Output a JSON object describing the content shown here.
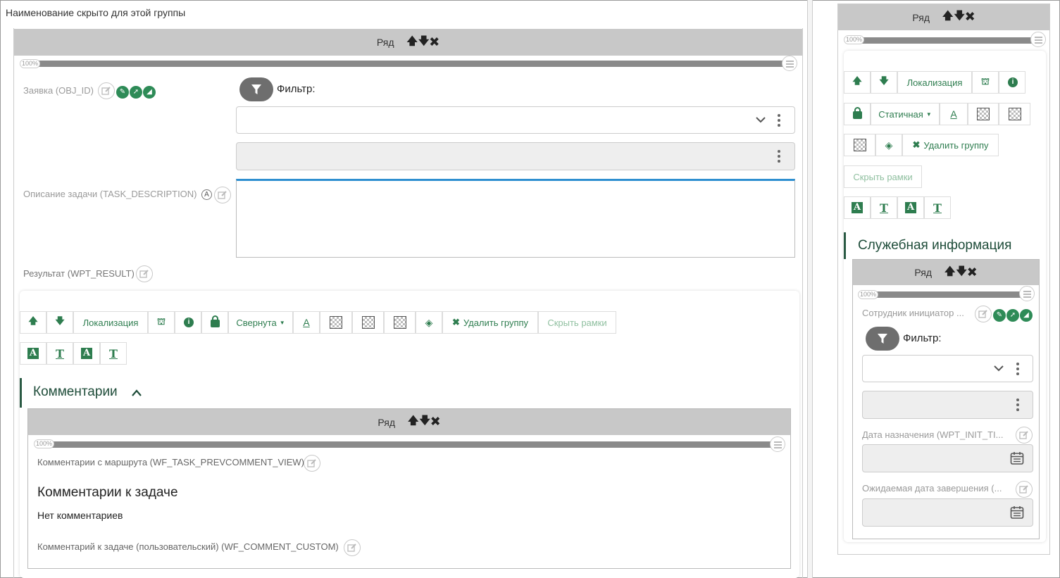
{
  "group_title": "Наименование скрыто для этой группы",
  "row_label": "Ряд",
  "row_controls": "🡅🡇✖",
  "percent": "100%",
  "main": {
    "obj_id_label": "Заявка (OBJ_ID)",
    "filter_label": "Фильтр:",
    "task_desc_label": "Описание задачи (TASK_DESCRIPTION)",
    "result_label": "Результат (WPT_RESULT)"
  },
  "toolbar": {
    "localization": "Локализация",
    "collapsed": "Свернута",
    "static": "Статичная",
    "delete_group": "Удалить группу",
    "hide_frames": "Скрыть рамки",
    "a_letter": "A",
    "t_letter": "T"
  },
  "comments": {
    "section_title": "Комментарии",
    "route_comments_label": "Комментарии с маршрута (WF_TASK_PREVCOMMENT_VIEW)",
    "task_comments_title": "Комментарии к задаче",
    "no_comments": "Нет комментариев",
    "custom_comment_label": "Комментарий к задаче (пользовательский) (WF_COMMENT_CUSTOM)"
  },
  "side": {
    "section_title": "Служебная информация",
    "initiator_label": "Сотрудник инициатор ...",
    "filter_label": "Фильтр:",
    "init_date_label": "Дата назначения (WPT_INIT_TI...",
    "due_date_label": "Ожидаемая дата завершения (..."
  },
  "colors": {
    "accent": "#2e7d4f",
    "rowbar": "#c8c8c8",
    "blue_line": "#2e8fd0"
  }
}
